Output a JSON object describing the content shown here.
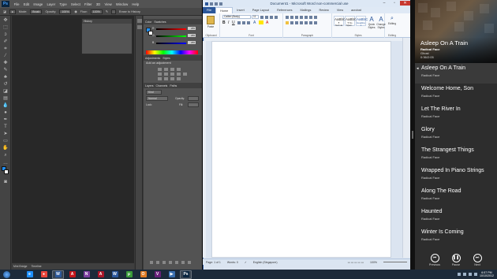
{
  "photoshop": {
    "logo": "Ps",
    "menus": [
      "File",
      "Edit",
      "Image",
      "Layer",
      "Type",
      "Select",
      "Filter",
      "3D",
      "View",
      "Window",
      "Help"
    ],
    "options": {
      "mode_label": "Mode:",
      "mode_value": "Brush",
      "opacity_label": "Opacity:",
      "opacity_value": "100%",
      "flow_label": "Flow:",
      "flow_value": "100%",
      "erase_label": "Erase to History"
    },
    "history_title": "History",
    "color_tabs": [
      "Color",
      "Swatches"
    ],
    "color_sliders": [
      {
        "label": "R",
        "value": "255"
      },
      {
        "label": "G",
        "value": "255"
      },
      {
        "label": "B",
        "value": "255"
      }
    ],
    "adjust_tabs": [
      "Adjustments",
      "Styles"
    ],
    "adjust_title": "Add an adjustment",
    "layers_tabs": [
      "Layers",
      "Channels",
      "Paths"
    ],
    "layers_kind": "Kind",
    "layers_blend": "Normal",
    "layers_opacity": "Opacity:",
    "layers_lock": "Lock:",
    "layers_fill": "Fill:",
    "bottom_tabs": [
      "Mini Bridge",
      "Timeline"
    ]
  },
  "word": {
    "title": "Document1 - Microsoft Word non-commercial use",
    "tabs": [
      "File",
      "Home",
      "Insert",
      "Page Layout",
      "References",
      "Mailings",
      "Review",
      "View",
      "acrobat"
    ],
    "font_name": "Calibri (Body)",
    "font_size": "11",
    "paste_label": "Paste",
    "groups": [
      "Clipboard",
      "Font",
      "Paragraph",
      "Styles",
      "Editing"
    ],
    "styles": [
      {
        "sample": "AaBbCcDc",
        "name": "¶ Normal"
      },
      {
        "sample": "AaBbCcDc",
        "name": "¶ No Spaci..."
      },
      {
        "sample": "AaBbC",
        "name": "Heading 1"
      }
    ],
    "quick_styles": "Quick Styles",
    "change_styles": "Change Styles",
    "editing_label": "Editing",
    "status": {
      "page": "Page: 1 of 1",
      "words": "Words: 0",
      "language": "English (Singapore)",
      "zoom": "100%"
    }
  },
  "music": {
    "now_playing": {
      "title": "Asleep On A Train",
      "artist": "Radical Face",
      "album": "Ghost",
      "time": "0:36/2:05"
    },
    "tracks": [
      {
        "title": "Asleep On A Train",
        "artist": "Radical Face"
      },
      {
        "title": "Welcome Home, Son",
        "artist": "Radical Face"
      },
      {
        "title": "Let The River In",
        "artist": "Radical Face"
      },
      {
        "title": "Glory",
        "artist": "Radical Face"
      },
      {
        "title": "The Strangest Things",
        "artist": "Radical Face"
      },
      {
        "title": "Wrapped In Piano Strings",
        "artist": "Radical Face"
      },
      {
        "title": "Along The Road",
        "artist": "Radical Face"
      },
      {
        "title": "Haunted",
        "artist": "Radical Face"
      },
      {
        "title": "Winter Is Coming",
        "artist": "Radical Face"
      }
    ],
    "controls": {
      "previous": "Previous",
      "pause": "Pause",
      "next": "Next"
    }
  },
  "taskbar": {
    "apps": [
      {
        "name": "ie",
        "glyph": "e",
        "color": "#1e90ff"
      },
      {
        "name": "chrome",
        "glyph": "●",
        "color": "#e8453c"
      },
      {
        "name": "word",
        "glyph": "W",
        "color": "#2b579a"
      },
      {
        "name": "acrobat",
        "glyph": "A",
        "color": "#c4161c"
      },
      {
        "name": "onenote",
        "glyph": "N",
        "color": "#7b3fa0"
      },
      {
        "name": "acrobat-pro",
        "glyph": "A",
        "color": "#a8162a"
      },
      {
        "name": "word-2",
        "glyph": "W",
        "color": "#2b579a"
      },
      {
        "name": "torrent",
        "glyph": "µ",
        "color": "#3a9a3a"
      },
      {
        "name": "outlook",
        "glyph": "O",
        "color": "#e07b24"
      },
      {
        "name": "visual-studio",
        "glyph": "V",
        "color": "#68217a"
      },
      {
        "name": "media",
        "glyph": "▶",
        "color": "#3a6fb0"
      },
      {
        "name": "photoshop",
        "glyph": "Ps",
        "color": "#0a2540"
      }
    ],
    "clock_time": "6:57 PM",
    "clock_date": "10/10/2012"
  }
}
